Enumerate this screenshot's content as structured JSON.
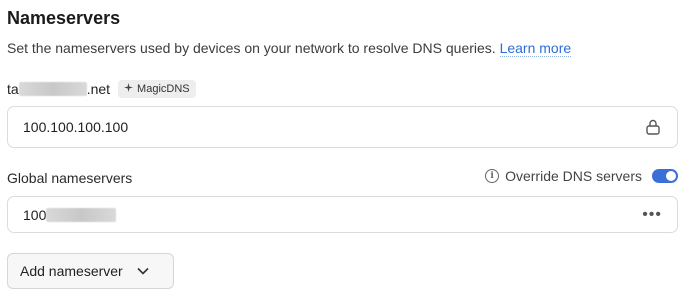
{
  "section": {
    "title": "Nameservers",
    "description": "Set the nameservers used by devices on your network to resolve DNS queries.",
    "learn_more": "Learn more"
  },
  "tailnet": {
    "domain_prefix": "ta",
    "domain_suffix": ".net",
    "badge_label": "MagicDNS",
    "badge_icon": "sparkle-icon",
    "nameserver_value": "100.100.100.100",
    "field_icon": "lock-icon"
  },
  "global": {
    "label": "Global nameservers",
    "override_label": "Override DNS servers",
    "override_enabled": true,
    "nameserver_value_prefix": "100",
    "field_icon": "more-dots-icon"
  },
  "actions": {
    "add_label": "Add nameserver"
  },
  "colors": {
    "accent": "#3b6fd8",
    "link": "#2b6fd6"
  }
}
